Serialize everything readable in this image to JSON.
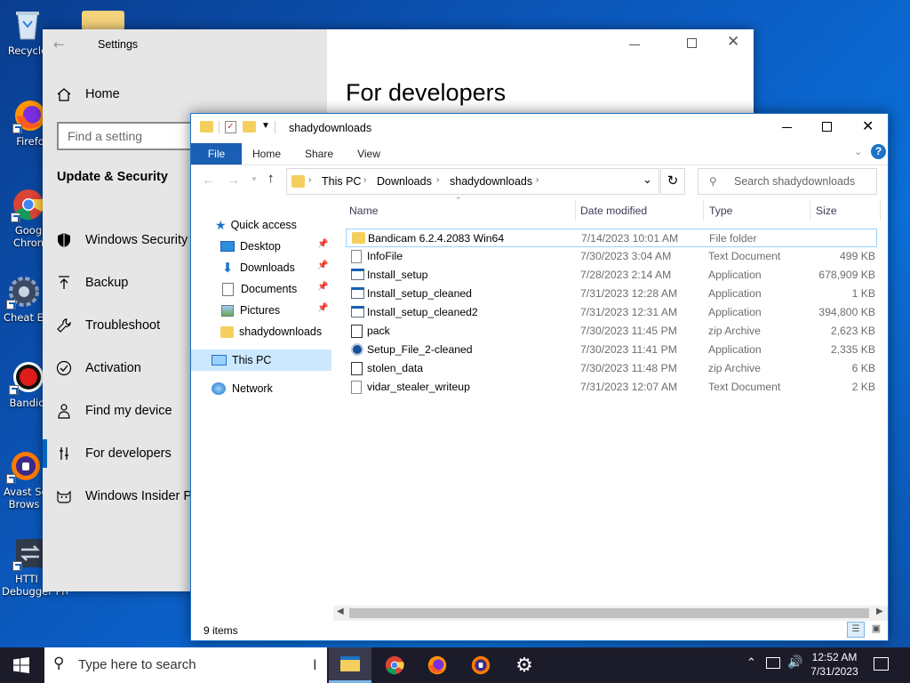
{
  "desktop": {
    "icons": [
      {
        "label": "Recycle",
        "icon": "recycle-bin-icon"
      },
      {
        "label": "Firefo",
        "icon": "firefox-icon"
      },
      {
        "label": "Goog",
        "label2": "Chron",
        "icon": "chrome-icon"
      },
      {
        "label": "Cheat En",
        "icon": "cheat-engine-icon"
      },
      {
        "label": "Bandic",
        "icon": "bandicam-icon"
      },
      {
        "label": "Avast Se",
        "label2": "Brows",
        "icon": "avast-browser-icon"
      },
      {
        "label": "HTTI",
        "label2": "Debugger Pro",
        "icon": "http-debugger-icon"
      }
    ]
  },
  "settings": {
    "title": "Settings",
    "home": "Home",
    "search_placeholder": "Find a setting",
    "section": "Update & Security",
    "page_heading": "For developers",
    "items": [
      {
        "label": "Windows Security",
        "icon": "shield-icon"
      },
      {
        "label": "Backup",
        "icon": "backup-arrow-icon"
      },
      {
        "label": "Troubleshoot",
        "icon": "wrench-icon"
      },
      {
        "label": "Activation",
        "icon": "check-circle-icon"
      },
      {
        "label": "Find my device",
        "icon": "person-pin-icon"
      },
      {
        "label": "For developers",
        "icon": "developer-tools-icon"
      },
      {
        "label": "Windows Insider Pr",
        "icon": "insider-cat-icon"
      }
    ]
  },
  "explorer": {
    "title": "shadydownloads",
    "ribbon": {
      "file": "File",
      "home": "Home",
      "share": "Share",
      "view": "View"
    },
    "address": {
      "crumbs": [
        "This PC",
        "Downloads",
        "shadydownloads"
      ]
    },
    "search_placeholder": "Search shadydownloads",
    "nav": {
      "quick_access": "Quick access",
      "items": [
        "Desktop",
        "Downloads",
        "Documents",
        "Pictures",
        "shadydownloads"
      ],
      "this_pc": "This PC",
      "network": "Network"
    },
    "columns": {
      "name": "Name",
      "date": "Date modified",
      "type": "Type",
      "size": "Size"
    },
    "files": [
      {
        "name": "Bandicam 6.2.4.2083 Win64",
        "date": "7/14/2023 10:01 AM",
        "type": "File folder",
        "size": "",
        "icon": "folder-icon"
      },
      {
        "name": "InfoFile",
        "date": "7/30/2023 3:04 AM",
        "type": "Text Document",
        "size": "499 KB",
        "icon": "text-document-icon"
      },
      {
        "name": "Install_setup",
        "date": "7/28/2023 2:14 AM",
        "type": "Application",
        "size": "678,909 KB",
        "icon": "application-icon"
      },
      {
        "name": "Install_setup_cleaned",
        "date": "7/31/2023 12:28 AM",
        "type": "Application",
        "size": "1 KB",
        "icon": "application-icon"
      },
      {
        "name": "Install_setup_cleaned2",
        "date": "7/31/2023 12:31 AM",
        "type": "Application",
        "size": "394,800 KB",
        "icon": "application-icon"
      },
      {
        "name": "pack",
        "date": "7/30/2023 11:45 PM",
        "type": "zip Archive",
        "size": "2,623 KB",
        "icon": "zip-archive-icon"
      },
      {
        "name": "Setup_File_2-cleaned",
        "date": "7/30/2023 11:41 PM",
        "type": "Application",
        "size": "2,335 KB",
        "icon": "setup-application-icon"
      },
      {
        "name": "stolen_data",
        "date": "7/30/2023 11:48 PM",
        "type": "zip Archive",
        "size": "6 KB",
        "icon": "zip-archive-icon"
      },
      {
        "name": "vidar_stealer_writeup",
        "date": "7/31/2023 12:07 AM",
        "type": "Text Document",
        "size": "2 KB",
        "icon": "text-document-icon"
      }
    ],
    "status": "9 items"
  },
  "taskbar": {
    "search_placeholder": "Type here to search",
    "time": "12:52 AM",
    "date": "7/31/2023"
  },
  "colors": {
    "accent": "#0067c0",
    "file_tab": "#1a5fb4",
    "taskbar": "#1b1b2a",
    "selection": "#cce8ff"
  }
}
